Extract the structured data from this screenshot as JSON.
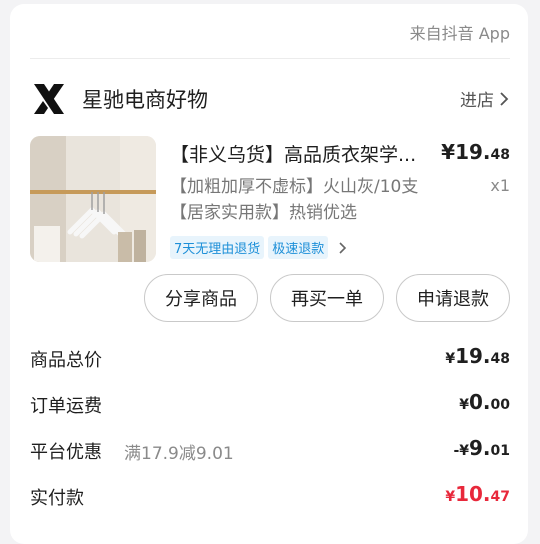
{
  "source": "来自抖音 App",
  "shop": {
    "name": "星驰电商好物",
    "enter_label": "进店"
  },
  "product": {
    "title": "【非义乌货】高品质衣架学...",
    "price_main": "¥19.",
    "price_cents": "48",
    "spec": "【加粗加厚不虚标】火山灰/10支 【居家实用款】热销优选",
    "quantity": "x1",
    "tags": [
      "7天无理由退货",
      "极速退款"
    ]
  },
  "actions": {
    "share": "分享商品",
    "rebuy": "再买一单",
    "refund": "申请退款"
  },
  "summary": {
    "total": {
      "label": "商品总价",
      "yen": "¥",
      "main": "19.",
      "cents": "48"
    },
    "shipping": {
      "label": "订单运费",
      "yen": "¥",
      "main": "0.",
      "cents": "00"
    },
    "discount": {
      "label": "平台优惠",
      "note": "满17.9减9.01",
      "yen": "-¥",
      "main": "9.",
      "cents": "01"
    },
    "paid": {
      "label": "实付款",
      "yen": "¥",
      "main": "10.",
      "cents": "47"
    }
  },
  "colors": {
    "accent_red": "#e8283b",
    "tag_blue": "#1d8fd8"
  }
}
